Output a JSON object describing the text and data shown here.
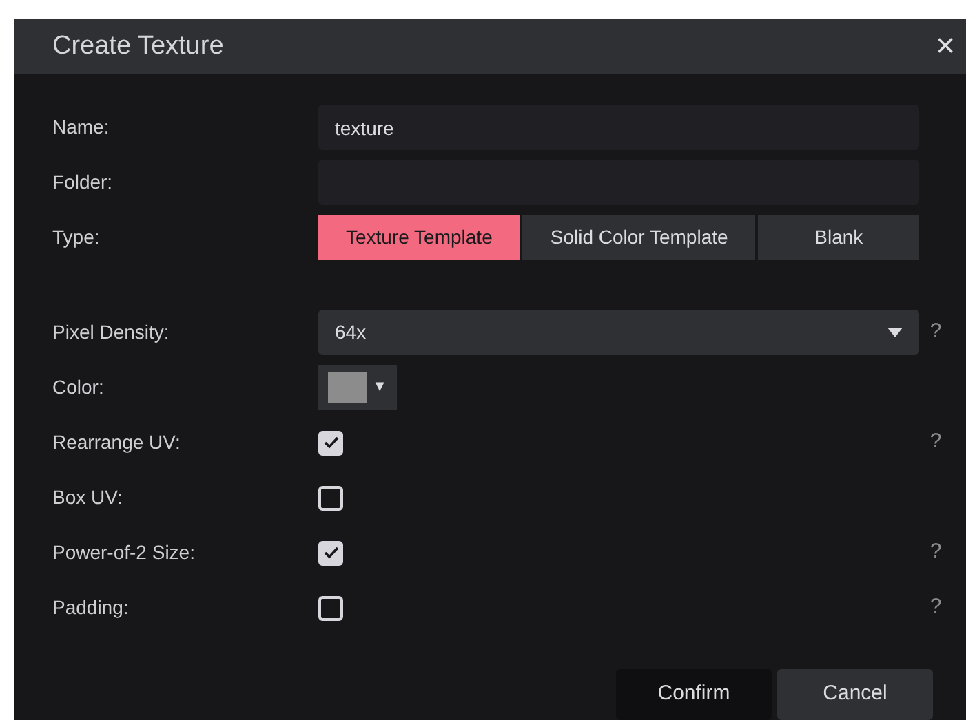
{
  "dialog": {
    "title": "Create Texture",
    "close": "×"
  },
  "fields": [
    {
      "kind": "text",
      "label": "Name:",
      "value": "texture"
    },
    {
      "kind": "text",
      "label": "Folder:"
    },
    {
      "kind": "segmented",
      "label": "Type:",
      "options": [
        {
          "label": "Texture Template",
          "selected": true
        },
        {
          "label": "Solid Color Template",
          "selected": false
        },
        {
          "label": "Blank",
          "selected": false
        }
      ]
    },
    {
      "kind": "spacer"
    },
    {
      "kind": "select",
      "label": "Pixel Density:",
      "value": "64x",
      "help": "?"
    },
    {
      "kind": "color",
      "label": "Color:",
      "color": "#8c8c8c",
      "caret": "▼"
    },
    {
      "kind": "checkbox",
      "label": "Rearrange UV:",
      "checked": true,
      "help": "?"
    },
    {
      "kind": "checkbox",
      "label": "Box UV:",
      "checked": false
    },
    {
      "kind": "checkbox",
      "label": "Power-of-2 Size:",
      "checked": true,
      "help": "?"
    },
    {
      "kind": "checkbox",
      "label": "Padding:",
      "checked": false,
      "help": "?"
    }
  ],
  "buttons": [
    {
      "label": "Confirm",
      "kind": "confirm"
    },
    {
      "label": "Cancel",
      "kind": "cancel"
    }
  ]
}
